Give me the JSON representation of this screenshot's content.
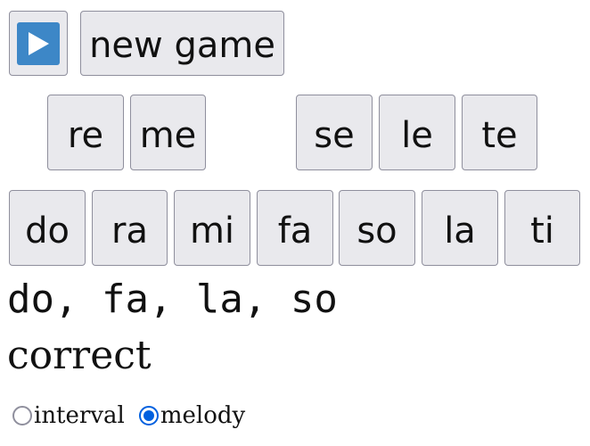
{
  "toolbar": {
    "play_icon": "play-icon",
    "new_game_label": "new game"
  },
  "chromatic_row": [
    "re",
    "me",
    "se",
    "le",
    "te"
  ],
  "diatonic_row": [
    "do",
    "ra",
    "mi",
    "fa",
    "so",
    "la",
    "ti"
  ],
  "answer_text": "do, fa, la, so",
  "status_text": "correct",
  "mode": {
    "options": [
      "interval",
      "melody"
    ],
    "selected": "melody"
  },
  "colors": {
    "play_icon_bg": "#3d87c7",
    "button_bg": "#e9e9ed",
    "radio_accent": "#0060df"
  }
}
